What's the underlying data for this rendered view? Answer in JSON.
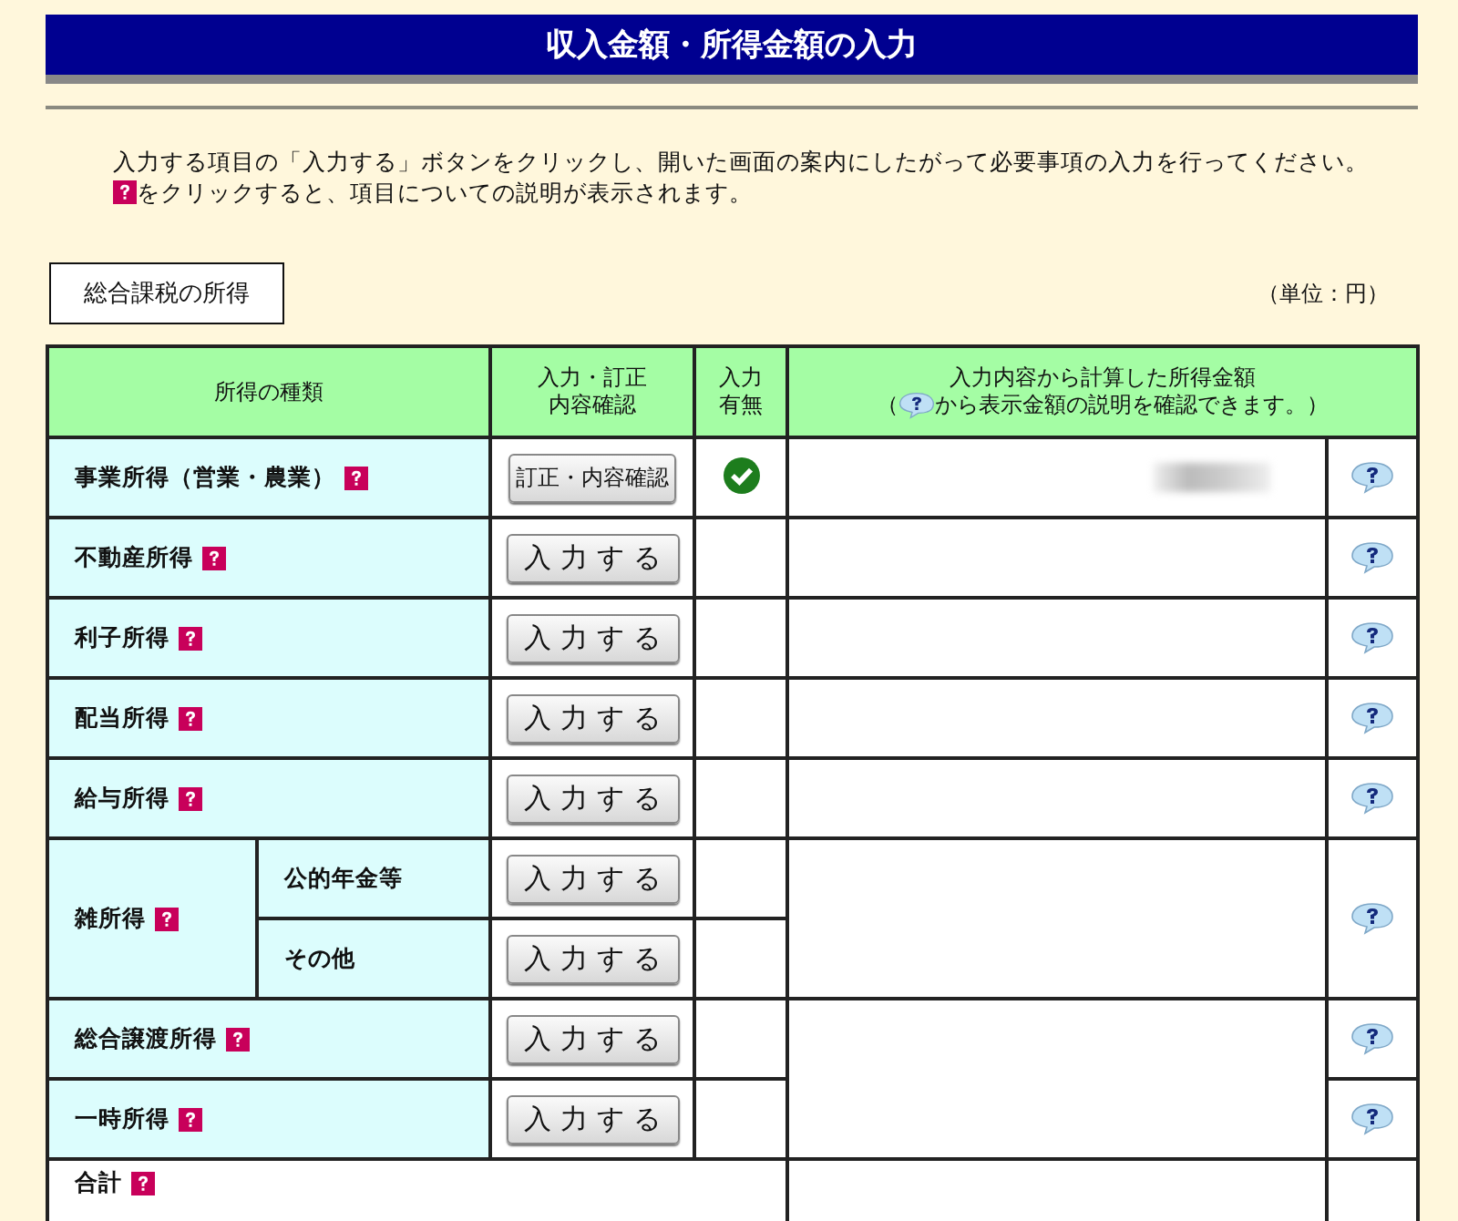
{
  "window": {
    "title": "収入金額・所得金額の入力"
  },
  "instructions": {
    "line_1": "入力する項目の「入力する」ボタンをクリックし、開いた画面の案内にしたがって必要事項の入力を行ってください。",
    "line_2": "をクリックすると、項目についての説明が表示されます。"
  },
  "section_tab": "総合課税の所得",
  "unit_note": "（単位：円）",
  "table": {
    "columns": [
      {
        "lines": [
          "所得の種類"
        ]
      },
      {
        "lines": [
          "入力・訂正",
          "内容確認"
        ]
      },
      {
        "lines": [
          "入力",
          "有無"
        ]
      },
      {
        "lines": [
          "入力内容から計算した所得金額"
        ],
        "note_before": "（",
        "note_after": "から表示金額の説明を確認できます。）"
      }
    ],
    "rows": [
      {
        "kind": "single",
        "label": "事業所得（営業・農業）",
        "button": "訂正・内容確認",
        "entered": true,
        "amount_blurred": true,
        "merged_with_previous": false
      },
      {
        "kind": "single",
        "label": "不動産所得",
        "button": "入力する",
        "entered": false,
        "amount_blurred": false,
        "merged_with_previous": false
      },
      {
        "kind": "single",
        "label": "利子所得",
        "button": "入力する",
        "entered": false,
        "amount_blurred": false,
        "merged_with_previous": false
      },
      {
        "kind": "single",
        "label": "配当所得",
        "button": "入力する",
        "entered": false,
        "amount_blurred": false,
        "merged_with_previous": false
      },
      {
        "kind": "single",
        "label": "給与所得",
        "button": "入力する",
        "entered": false,
        "amount_blurred": false,
        "merged_with_previous": false
      },
      {
        "kind": "group",
        "label": "雑所得",
        "children": [
          {
            "label": "公的年金等",
            "button": "入力する",
            "entered": false
          },
          {
            "label": "その他",
            "button": "入力する",
            "entered": false
          }
        ]
      },
      {
        "kind": "single",
        "label": "総合譲渡所得",
        "button": "入力する",
        "entered": false,
        "amount_blurred": false,
        "merged_with_previous": false
      },
      {
        "kind": "single",
        "label": "一時所得",
        "button": "入力する",
        "entered": false,
        "amount_blurred": false,
        "merged_with_previous": true
      },
      {
        "kind": "total",
        "label": "合計"
      }
    ]
  }
}
